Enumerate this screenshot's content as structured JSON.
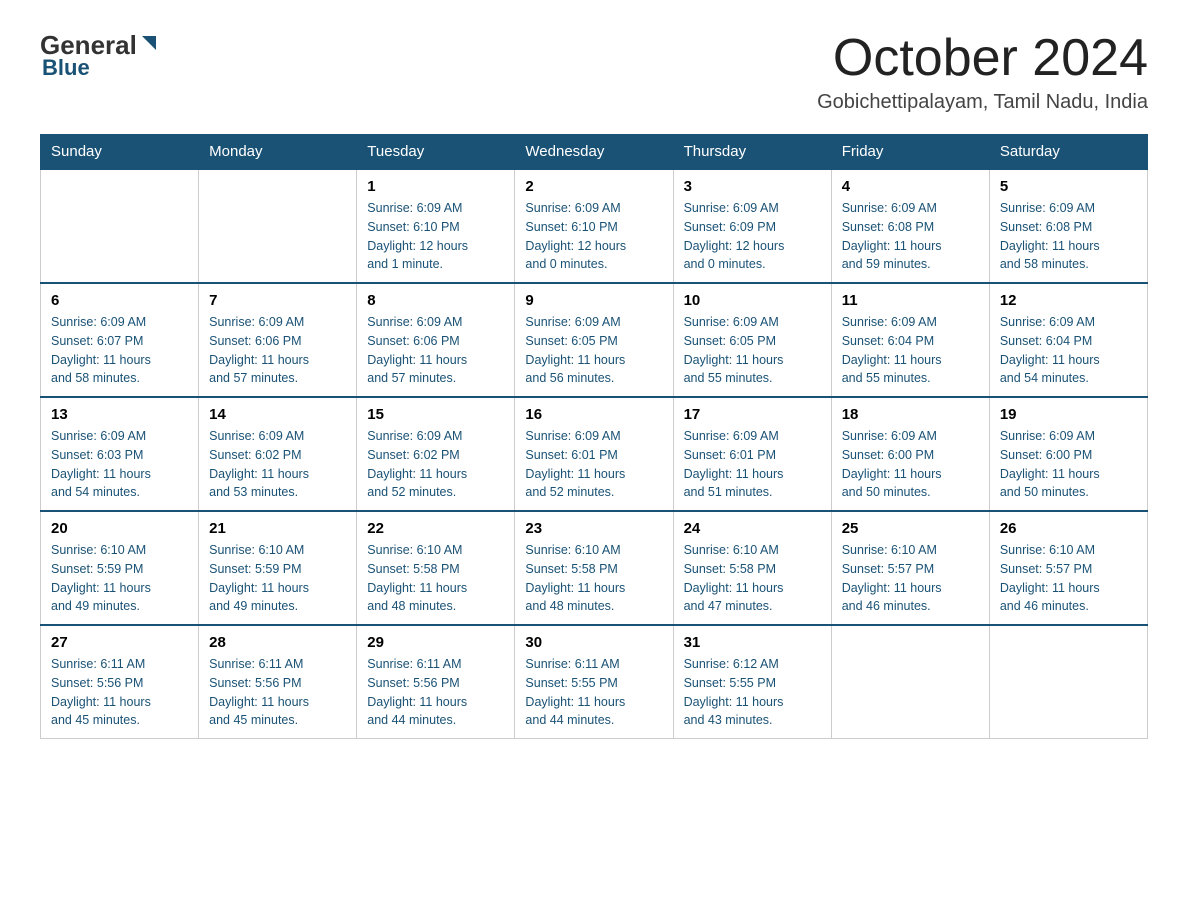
{
  "header": {
    "logo_general": "General",
    "logo_blue": "Blue",
    "month_year": "October 2024",
    "location": "Gobichettipalayam, Tamil Nadu, India"
  },
  "days_of_week": [
    "Sunday",
    "Monday",
    "Tuesday",
    "Wednesday",
    "Thursday",
    "Friday",
    "Saturday"
  ],
  "weeks": [
    [
      {
        "day": "",
        "info": ""
      },
      {
        "day": "",
        "info": ""
      },
      {
        "day": "1",
        "info": "Sunrise: 6:09 AM\nSunset: 6:10 PM\nDaylight: 12 hours\nand 1 minute."
      },
      {
        "day": "2",
        "info": "Sunrise: 6:09 AM\nSunset: 6:10 PM\nDaylight: 12 hours\nand 0 minutes."
      },
      {
        "day": "3",
        "info": "Sunrise: 6:09 AM\nSunset: 6:09 PM\nDaylight: 12 hours\nand 0 minutes."
      },
      {
        "day": "4",
        "info": "Sunrise: 6:09 AM\nSunset: 6:08 PM\nDaylight: 11 hours\nand 59 minutes."
      },
      {
        "day": "5",
        "info": "Sunrise: 6:09 AM\nSunset: 6:08 PM\nDaylight: 11 hours\nand 58 minutes."
      }
    ],
    [
      {
        "day": "6",
        "info": "Sunrise: 6:09 AM\nSunset: 6:07 PM\nDaylight: 11 hours\nand 58 minutes."
      },
      {
        "day": "7",
        "info": "Sunrise: 6:09 AM\nSunset: 6:06 PM\nDaylight: 11 hours\nand 57 minutes."
      },
      {
        "day": "8",
        "info": "Sunrise: 6:09 AM\nSunset: 6:06 PM\nDaylight: 11 hours\nand 57 minutes."
      },
      {
        "day": "9",
        "info": "Sunrise: 6:09 AM\nSunset: 6:05 PM\nDaylight: 11 hours\nand 56 minutes."
      },
      {
        "day": "10",
        "info": "Sunrise: 6:09 AM\nSunset: 6:05 PM\nDaylight: 11 hours\nand 55 minutes."
      },
      {
        "day": "11",
        "info": "Sunrise: 6:09 AM\nSunset: 6:04 PM\nDaylight: 11 hours\nand 55 minutes."
      },
      {
        "day": "12",
        "info": "Sunrise: 6:09 AM\nSunset: 6:04 PM\nDaylight: 11 hours\nand 54 minutes."
      }
    ],
    [
      {
        "day": "13",
        "info": "Sunrise: 6:09 AM\nSunset: 6:03 PM\nDaylight: 11 hours\nand 54 minutes."
      },
      {
        "day": "14",
        "info": "Sunrise: 6:09 AM\nSunset: 6:02 PM\nDaylight: 11 hours\nand 53 minutes."
      },
      {
        "day": "15",
        "info": "Sunrise: 6:09 AM\nSunset: 6:02 PM\nDaylight: 11 hours\nand 52 minutes."
      },
      {
        "day": "16",
        "info": "Sunrise: 6:09 AM\nSunset: 6:01 PM\nDaylight: 11 hours\nand 52 minutes."
      },
      {
        "day": "17",
        "info": "Sunrise: 6:09 AM\nSunset: 6:01 PM\nDaylight: 11 hours\nand 51 minutes."
      },
      {
        "day": "18",
        "info": "Sunrise: 6:09 AM\nSunset: 6:00 PM\nDaylight: 11 hours\nand 50 minutes."
      },
      {
        "day": "19",
        "info": "Sunrise: 6:09 AM\nSunset: 6:00 PM\nDaylight: 11 hours\nand 50 minutes."
      }
    ],
    [
      {
        "day": "20",
        "info": "Sunrise: 6:10 AM\nSunset: 5:59 PM\nDaylight: 11 hours\nand 49 minutes."
      },
      {
        "day": "21",
        "info": "Sunrise: 6:10 AM\nSunset: 5:59 PM\nDaylight: 11 hours\nand 49 minutes."
      },
      {
        "day": "22",
        "info": "Sunrise: 6:10 AM\nSunset: 5:58 PM\nDaylight: 11 hours\nand 48 minutes."
      },
      {
        "day": "23",
        "info": "Sunrise: 6:10 AM\nSunset: 5:58 PM\nDaylight: 11 hours\nand 48 minutes."
      },
      {
        "day": "24",
        "info": "Sunrise: 6:10 AM\nSunset: 5:58 PM\nDaylight: 11 hours\nand 47 minutes."
      },
      {
        "day": "25",
        "info": "Sunrise: 6:10 AM\nSunset: 5:57 PM\nDaylight: 11 hours\nand 46 minutes."
      },
      {
        "day": "26",
        "info": "Sunrise: 6:10 AM\nSunset: 5:57 PM\nDaylight: 11 hours\nand 46 minutes."
      }
    ],
    [
      {
        "day": "27",
        "info": "Sunrise: 6:11 AM\nSunset: 5:56 PM\nDaylight: 11 hours\nand 45 minutes."
      },
      {
        "day": "28",
        "info": "Sunrise: 6:11 AM\nSunset: 5:56 PM\nDaylight: 11 hours\nand 45 minutes."
      },
      {
        "day": "29",
        "info": "Sunrise: 6:11 AM\nSunset: 5:56 PM\nDaylight: 11 hours\nand 44 minutes."
      },
      {
        "day": "30",
        "info": "Sunrise: 6:11 AM\nSunset: 5:55 PM\nDaylight: 11 hours\nand 44 minutes."
      },
      {
        "day": "31",
        "info": "Sunrise: 6:12 AM\nSunset: 5:55 PM\nDaylight: 11 hours\nand 43 minutes."
      },
      {
        "day": "",
        "info": ""
      },
      {
        "day": "",
        "info": ""
      }
    ]
  ]
}
